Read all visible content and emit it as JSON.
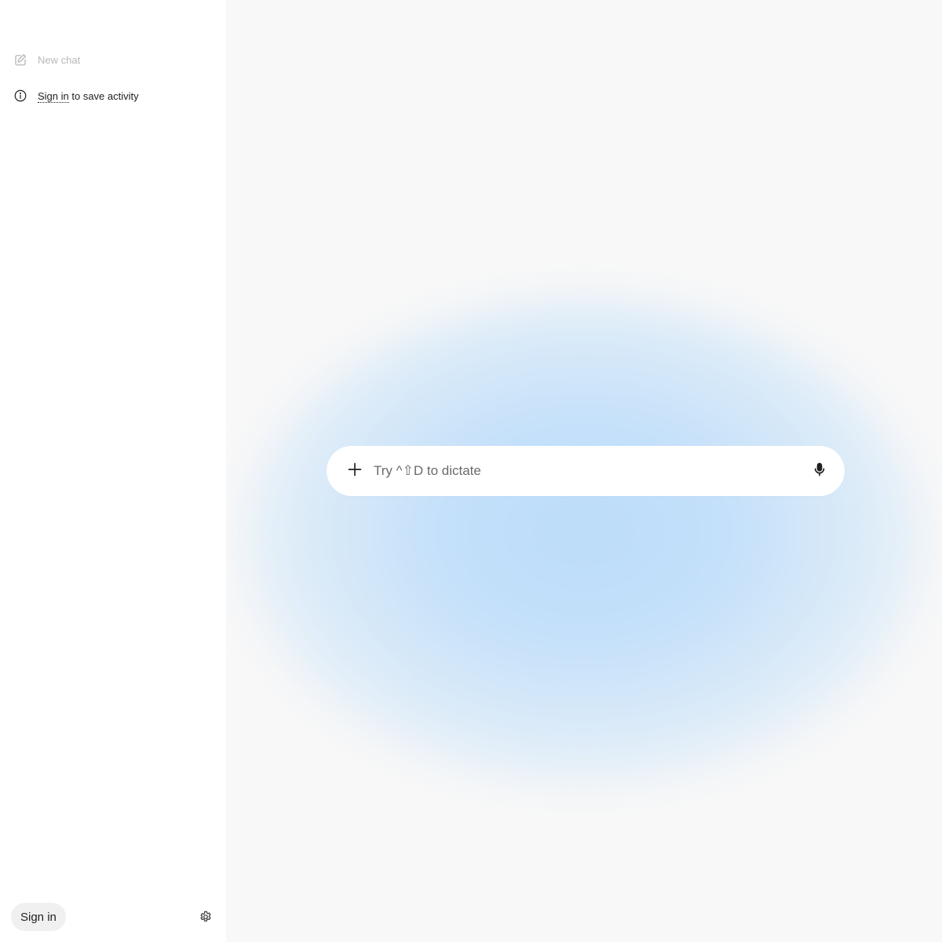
{
  "sidebar": {
    "new_chat_label": "New chat",
    "signin_link": "Sign in",
    "signin_note_rest": " to save activity",
    "signin_button": "Sign in",
    "icons": {
      "new_chat": "edit-pencil-icon",
      "info": "info-icon",
      "settings": "gear-icon"
    }
  },
  "composer": {
    "placeholder": "Try ^⇧D to dictate",
    "value": "",
    "icons": {
      "add": "plus-icon",
      "mic": "microphone-icon"
    }
  },
  "colors": {
    "sidebar_bg": "#ffffff",
    "main_bg": "#f8f8f8",
    "glow": "#bcdcf9",
    "signin_button_bg": "#f0f0f0",
    "muted_text": "#b8b8b8",
    "text": "#1f1f1f"
  }
}
